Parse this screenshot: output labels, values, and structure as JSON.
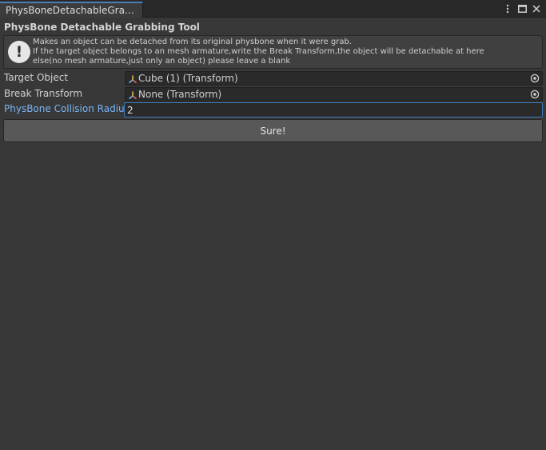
{
  "tab": {
    "title": "PhysBoneDetachableGra…"
  },
  "window_controls": {
    "menu_icon": "more-vertical-icon",
    "maximize_icon": "maximize-icon",
    "close_icon": "close-icon"
  },
  "header": {
    "title": "PhysBone Detachable Grabbing Tool"
  },
  "help": {
    "icon": "info-exclamation-icon",
    "lines": [
      "Makes an object can be detached from its original physbone when it were grab.",
      "If the target object belongs to an mesh armature,write the Break Transform,the object will be detachable at here",
      "else(no mesh armature,just only an object) please leave a blank"
    ]
  },
  "fields": {
    "target_object": {
      "label": "Target Object",
      "value": "Cube (1) (Transform)"
    },
    "break_transform": {
      "label": "Break Transform",
      "value": "None (Transform)"
    },
    "collision_radius": {
      "label": "PhysBone Collision Radius",
      "value": "2"
    }
  },
  "actions": {
    "submit_label": "Sure!"
  },
  "colors": {
    "background": "#383838",
    "focus_accent": "#3a79bb",
    "active_label": "#7ab4f5"
  }
}
